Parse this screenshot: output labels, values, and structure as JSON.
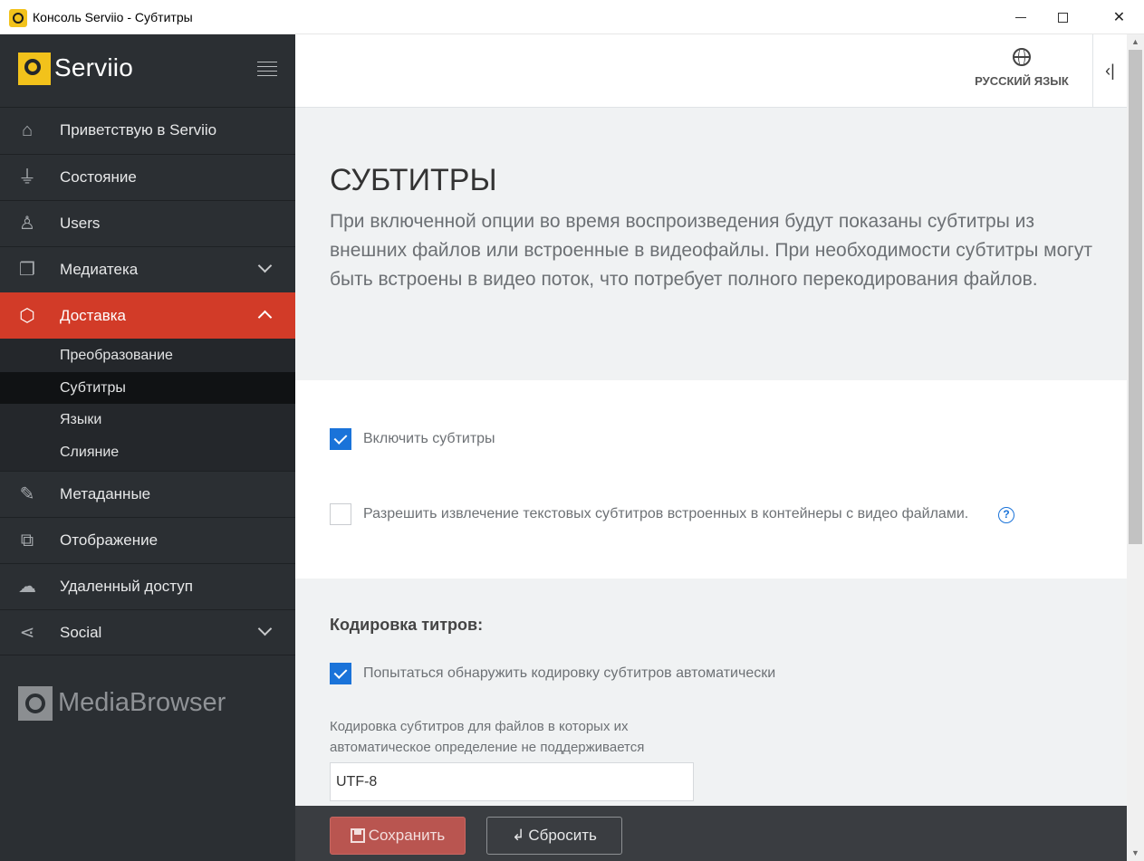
{
  "window": {
    "title": "Консоль Serviio - Субтитры",
    "minimize_glyph": "",
    "close_glyph": "✕"
  },
  "sidebar": {
    "brand": "Serviio",
    "items": [
      {
        "label": "Приветствую в Serviio",
        "icon": "home-icon"
      },
      {
        "label": "Состояние",
        "icon": "plug-icon"
      },
      {
        "label": "Users",
        "icon": "user-icon"
      },
      {
        "label": "Медиатека",
        "icon": "library-icon",
        "expandable": true
      },
      {
        "label": "Доставка",
        "icon": "box-icon",
        "expandable": true,
        "expanded": true,
        "active": true
      },
      {
        "label": "Метаданные",
        "icon": "edit-icon"
      },
      {
        "label": "Отображение",
        "icon": "windows-icon"
      },
      {
        "label": "Удаленный доступ",
        "icon": "cloud-icon"
      },
      {
        "label": "Social",
        "icon": "share-icon",
        "expandable": true
      }
    ],
    "delivery_submenu": [
      {
        "label": "Преобразование"
      },
      {
        "label": "Субтитры",
        "selected": true
      },
      {
        "label": "Языки"
      },
      {
        "label": "Слияние"
      }
    ],
    "footer_brand": "MediaBrowser"
  },
  "topbar": {
    "language_label": "РУССКИЙ ЯЗЫК",
    "collapse_glyph": "‹|"
  },
  "page": {
    "title": "СУБТИТРЫ",
    "description": "При включенной опции во время воспроизведения будут показаны субтитры из внешних файлов или встроенные в видеофайлы. При необходимости субтитры могут быть встроены в видео поток, что потребует полного перекодирования файлов."
  },
  "options": {
    "enable_subtitles": {
      "label": "Включить субтитры",
      "checked": true
    },
    "extract_embedded": {
      "label": "Разрешить извлечение текстовых субтитров встроенных в контейнеры с видео файлами.",
      "checked": false
    },
    "help_glyph": "?"
  },
  "encoding": {
    "title": "Кодировка титров:",
    "auto_detect": {
      "label": "Попытаться обнаружить кодировку субтитров автоматически",
      "checked": true
    },
    "field_label": "Кодировка субтитров для файлов в которых их автоматическое определение не поддерживается",
    "field_value": "UTF-8"
  },
  "footer": {
    "save_label": "Сохранить",
    "reset_label": "Сбросить",
    "reset_glyph": "↲"
  },
  "colors": {
    "accent": "#d23b28",
    "sidebar_bg": "#2b2f33",
    "checkbox_blue": "#1a73d9",
    "save_button": "#b95550"
  }
}
